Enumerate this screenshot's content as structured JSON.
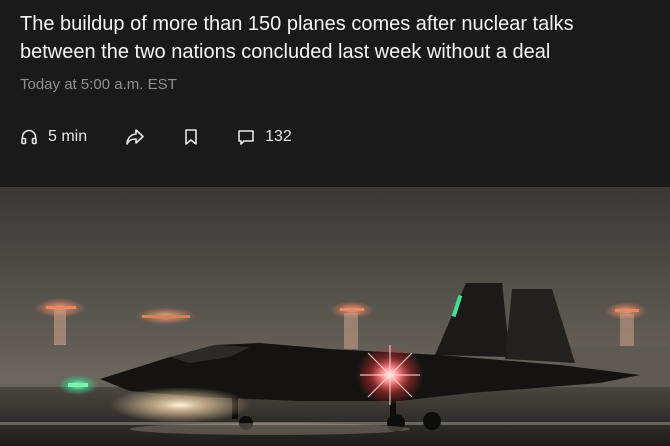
{
  "article": {
    "subheadline": "The buildup of more than 150 planes comes after nuclear talks between the two nations concluded last week without a deal",
    "timestamp": "Today at 5:00 a.m. EST"
  },
  "actions": {
    "listen_label": "5 min",
    "comments_count": "132",
    "icons": [
      "headphones-icon",
      "share-arrow-icon",
      "bookmark-icon",
      "comment-icon"
    ]
  },
  "colors": {
    "background": "#1a1a1a",
    "text": "#f4f4f4",
    "muted": "#8f8f8f"
  }
}
